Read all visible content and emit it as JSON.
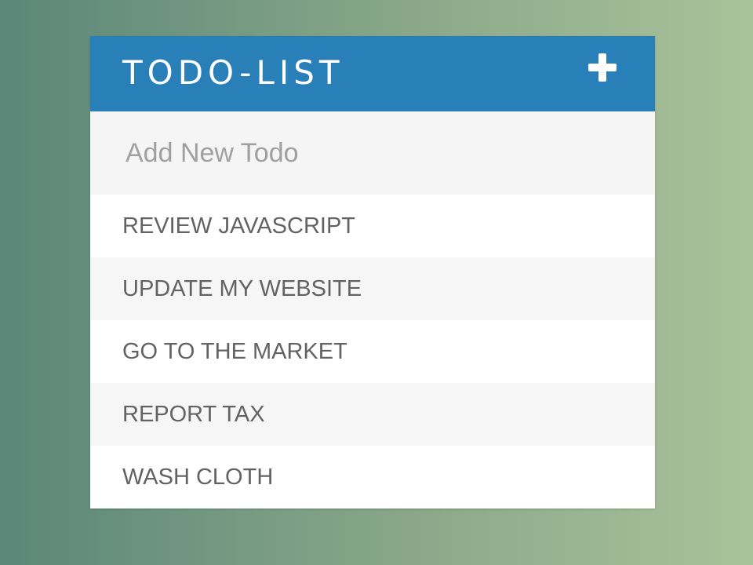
{
  "header": {
    "title": "TODO-LIST",
    "add_icon": "plus-icon",
    "color": "#2980b9"
  },
  "new_todo": {
    "placeholder": "Add New Todo",
    "value": ""
  },
  "todos": [
    {
      "text": "REVIEW JAVASCRIPT"
    },
    {
      "text": "UPDATE MY WEBSITE"
    },
    {
      "text": "GO TO THE MARKET"
    },
    {
      "text": "REPORT TAX"
    },
    {
      "text": "WASH CLOTH"
    }
  ]
}
